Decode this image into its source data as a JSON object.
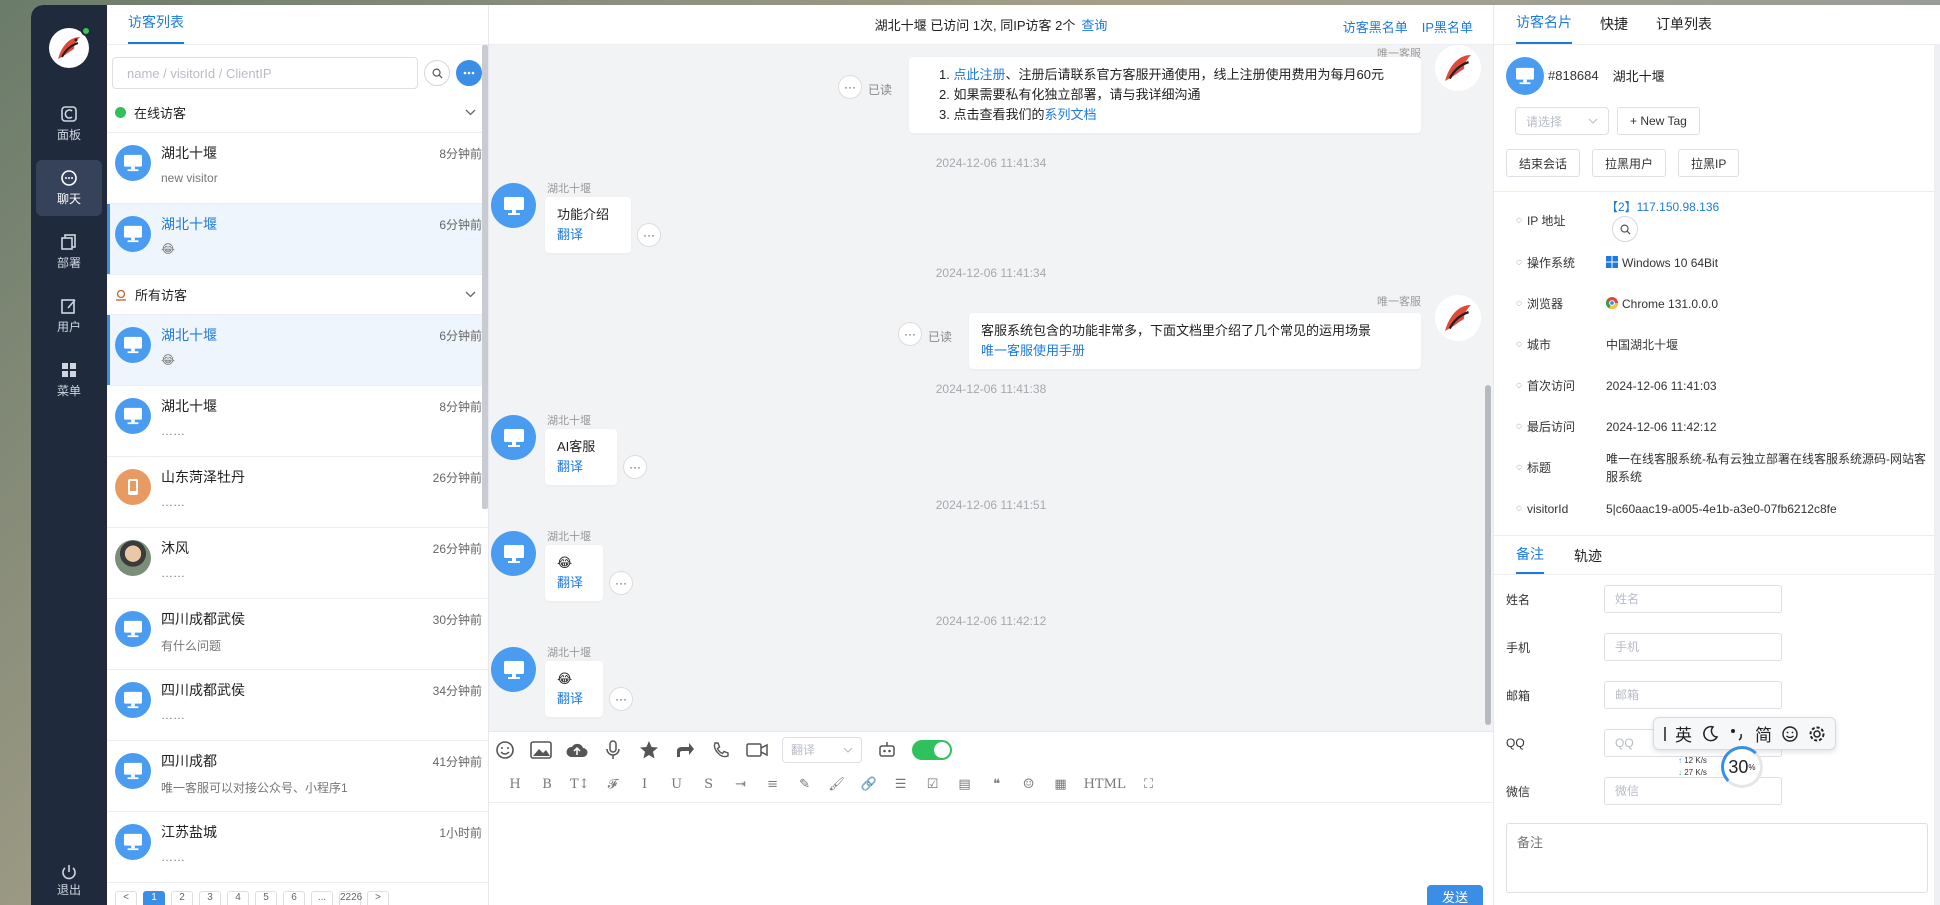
{
  "nav": {
    "items": [
      {
        "label": "面板",
        "icon": "dashboard-icon"
      },
      {
        "label": "聊天",
        "icon": "chat-icon",
        "active": true
      },
      {
        "label": "部署",
        "icon": "deploy-icon"
      },
      {
        "label": "用户",
        "icon": "user-edit-icon"
      },
      {
        "label": "菜单",
        "icon": "grid-menu-icon"
      }
    ],
    "logout": "退出"
  },
  "visitor_list": {
    "tab": "访客列表",
    "search_placeholder": "name / visitorId / ClientIP",
    "online_group": "在线访客",
    "all_group": "所有访客",
    "online": [
      {
        "name": "湖北十堰",
        "time": "8分钟前",
        "msg": "new visitor"
      },
      {
        "name": "湖北十堰",
        "time": "6分钟前",
        "msg": "😂",
        "active": true
      }
    ],
    "all": [
      {
        "name": "湖北十堰",
        "time": "6分钟前",
        "msg": "😂",
        "active": true,
        "avatar": "monitor"
      },
      {
        "name": "湖北十堰",
        "time": "8分钟前",
        "msg": "……",
        "avatar": "monitor"
      },
      {
        "name": "山东菏泽牡丹",
        "time": "26分钟前",
        "msg": "……",
        "avatar": "phone"
      },
      {
        "name": "沐风",
        "time": "26分钟前",
        "msg": "……",
        "avatar": "photo"
      },
      {
        "name": "四川成都武侯",
        "time": "30分钟前",
        "msg": "有什么问题",
        "avatar": "monitor"
      },
      {
        "name": "四川成都武侯",
        "time": "34分钟前",
        "msg": "……",
        "avatar": "monitor"
      },
      {
        "name": "四川成都",
        "time": "41分钟前",
        "msg": "唯一客服可以对接公众号、小程序1",
        "avatar": "monitor"
      },
      {
        "name": "江苏盐城",
        "time": "1小时前",
        "msg": "……",
        "avatar": "monitor"
      }
    ],
    "pager": [
      "<",
      "1",
      "2",
      "3",
      "4",
      "5",
      "6",
      "...",
      "2226",
      ">"
    ]
  },
  "chat": {
    "header_text": "湖北十堰 已访问 1次, 同IP访客 2个",
    "header_link": "查询",
    "blacklist_visitor": "访客黑名单",
    "blacklist_ip": "IP黑名单",
    "agent_name": "唯一客服",
    "visitor_name": "湖北十堰",
    "read_label": "已读",
    "translate_label": "翻译",
    "first_msg": {
      "line1_link": "点此注册",
      "line1_rest": "、注册后请联系官方客服开通使用，线上注册使用费用为每月60元",
      "line2": "如果需要私有化独立部署，请与我详细沟通",
      "line3_pre": "点击查看我们的",
      "line3_link": "系列文档"
    },
    "ts1": "2024-12-06 11:41:34",
    "v_msg1": "功能介绍",
    "ts2": "2024-12-06 11:41:34",
    "agent_msg2": "客服系统包含的功能非常多，下面文档里介绍了几个常见的运用场景",
    "agent_msg2_link": "唯一客服使用手册",
    "ts3": "2024-12-06 11:41:38",
    "v_msg2": "AI客服",
    "ts4": "2024-12-06 11:41:51",
    "v_msg3": "😂",
    "ts5": "2024-12-06 11:42:12",
    "v_msg4": "😂",
    "translate_select": "翻译",
    "editor_tools": [
      "H",
      "B",
      "T↕",
      "𝓕",
      "I",
      "U",
      "S",
      "⇥",
      "≡",
      "✎",
      "🖌",
      "🔗",
      "☰",
      "☑",
      "▤",
      "❝",
      "☺",
      "▦",
      "HTML",
      "⛶"
    ],
    "send": "发送"
  },
  "right_panel": {
    "tabs": [
      "访客名片",
      "快捷",
      "订单列表"
    ],
    "visitor_id": "#818684",
    "visitor_name": "湖北十堰",
    "tag_select": "请选择",
    "new_tag": "+ New Tag",
    "actions": [
      "结束会话",
      "拉黑用户",
      "拉黑IP"
    ],
    "info": [
      {
        "k": "IP 地址",
        "v": "【2】117.150.98.136",
        "blue": true
      },
      {
        "k": "操作系统",
        "v": "Windows 10 64Bit"
      },
      {
        "k": "浏览器",
        "v": "Chrome 131.0.0.0"
      },
      {
        "k": "城市",
        "v": "中国湖北十堰"
      },
      {
        "k": "首次访问",
        "v": "2024-12-06 11:41:03"
      },
      {
        "k": "最后访问",
        "v": "2024-12-06 11:42:12"
      },
      {
        "k": "标题",
        "v": "唯一在线客服系统-私有云独立部署在线客服系统源码-网站客服系统"
      },
      {
        "k": "visitorId",
        "v": "5|c60aac19-a005-4e1b-a3e0-07fb6212c8fe"
      }
    ],
    "sub_tabs": [
      "备注",
      "轨迹"
    ],
    "form": [
      {
        "label": "姓名",
        "placeholder": "姓名"
      },
      {
        "label": "手机",
        "placeholder": "手机"
      },
      {
        "label": "邮箱",
        "placeholder": "邮箱"
      },
      {
        "label": "QQ",
        "placeholder": "QQ"
      },
      {
        "label": "微信",
        "placeholder": "微信"
      }
    ],
    "note_placeholder": "备注"
  },
  "ime": {
    "items": [
      "英",
      "简"
    ],
    "up": "12 K/s",
    "down": "27 K/s",
    "percent": "30",
    "percent_unit": "%"
  }
}
